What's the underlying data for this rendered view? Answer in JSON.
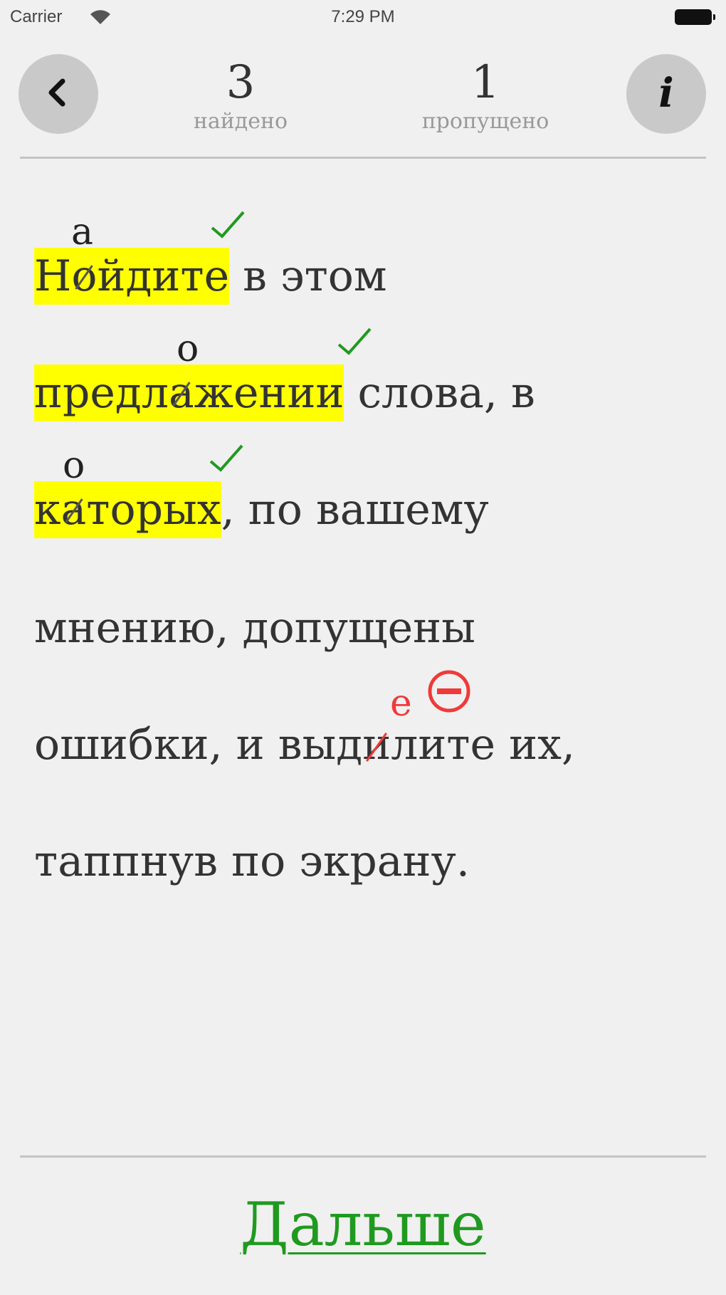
{
  "status_bar": {
    "carrier": "Carrier",
    "time": "7:29 PM"
  },
  "header": {
    "back_icon": "chevron-left-icon",
    "info_icon": "i",
    "found": {
      "count": "3",
      "label": "найдено"
    },
    "missed": {
      "count": "1",
      "label": "пропущено"
    }
  },
  "text": {
    "line1": {
      "w1_a": "Н",
      "w1_mark": "о",
      "w1_b": "йдите",
      "w1_corr": "а",
      "rest": " в этом"
    },
    "line2": {
      "w_a": "предл",
      "w_mark": "а",
      "w_b": "жении",
      "w_corr": "о",
      "rest": " слова, в"
    },
    "line3": {
      "w_a": "к",
      "w_mark": "а",
      "w_b": "торых",
      "w_corr": "о",
      "rest": ", по вашему"
    },
    "line4": {
      "rest": "мнению, допущены"
    },
    "line5": {
      "pre": "ошибки, и выд",
      "w_mark": "и",
      "post": "лите их,",
      "w_corr": "е"
    },
    "line6": {
      "rest": "таппнув по экрану."
    }
  },
  "footer": {
    "next_label": "Дальше"
  },
  "colors": {
    "highlight": "#ffff00",
    "correct": "#1f9a1f",
    "missed": "#f03a3a"
  }
}
